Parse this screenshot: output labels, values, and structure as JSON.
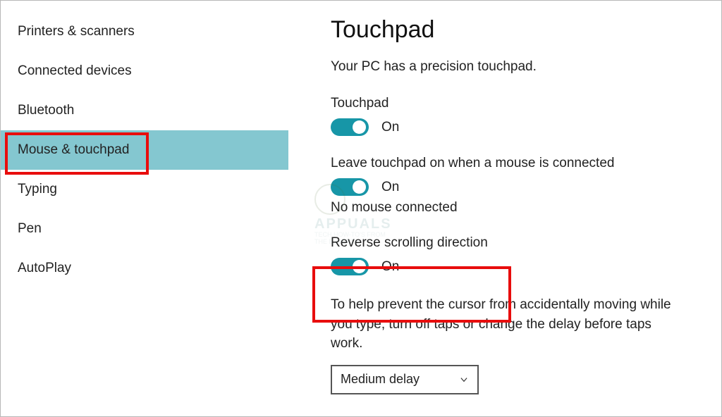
{
  "sidebar": {
    "items": [
      {
        "label": "Printers & scanners"
      },
      {
        "label": "Connected devices"
      },
      {
        "label": "Bluetooth"
      },
      {
        "label": "Mouse & touchpad"
      },
      {
        "label": "Typing"
      },
      {
        "label": "Pen"
      },
      {
        "label": "AutoPlay"
      }
    ],
    "selected_index": 3
  },
  "page": {
    "title": "Touchpad",
    "description": "Your PC has a precision touchpad."
  },
  "settings": {
    "touchpad": {
      "label": "Touchpad",
      "state": "On",
      "on": true
    },
    "leave_on": {
      "label": "Leave touchpad on when a mouse is connected",
      "state": "On",
      "on": true
    },
    "mouse_status": "No mouse connected",
    "reverse_scroll": {
      "label": "Reverse scrolling direction",
      "state": "On",
      "on": true
    },
    "cursor_help_text": "To help prevent the cursor from accidentally moving while you type, turn off taps or change the delay before taps work.",
    "delay": {
      "selected": "Medium delay"
    }
  },
  "colors": {
    "accent": "#1796a7",
    "sidebar_selected": "#84c7d0",
    "highlight": "#e80d0d"
  },
  "watermark": {
    "line1": "APPUALS",
    "line2": "TECH HOW-TO'S FROM",
    "line3": "THE EXPERTS"
  }
}
